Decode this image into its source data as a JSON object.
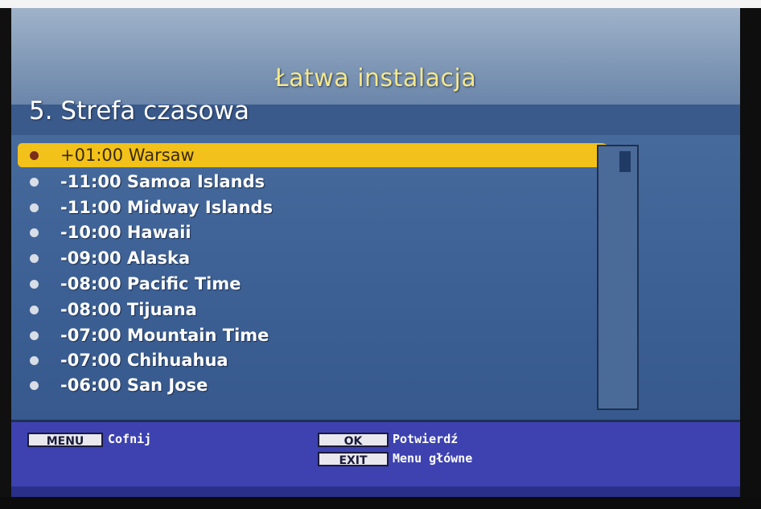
{
  "header": {
    "title": "Łatwa instalacja"
  },
  "step": {
    "title": "5. Strefa czasowa"
  },
  "timezones": [
    {
      "label": "+01:00 Warsaw",
      "selected": true
    },
    {
      "label": "-11:00 Samoa Islands",
      "selected": false
    },
    {
      "label": "-11:00 Midway Islands",
      "selected": false
    },
    {
      "label": "-10:00 Hawaii",
      "selected": false
    },
    {
      "label": "-09:00 Alaska",
      "selected": false
    },
    {
      "label": "-08:00 Pacific Time",
      "selected": false
    },
    {
      "label": "-08:00 Tijuana",
      "selected": false
    },
    {
      "label": "-07:00 Mountain Time",
      "selected": false
    },
    {
      "label": "-07:00 Chihuahua",
      "selected": false
    },
    {
      "label": "-06:00 San Jose",
      "selected": false
    }
  ],
  "footer": {
    "menu_key": "MENU",
    "menu_action": "Cofnij",
    "ok_key": "OK",
    "ok_action": "Potwierdź",
    "exit_key": "EXIT",
    "exit_action": "Menu główne"
  },
  "colors": {
    "highlight": "#f2c21a",
    "title": "#f5e88a",
    "list_bg": "#3d6195",
    "footer_bg": "#3d42b0"
  }
}
